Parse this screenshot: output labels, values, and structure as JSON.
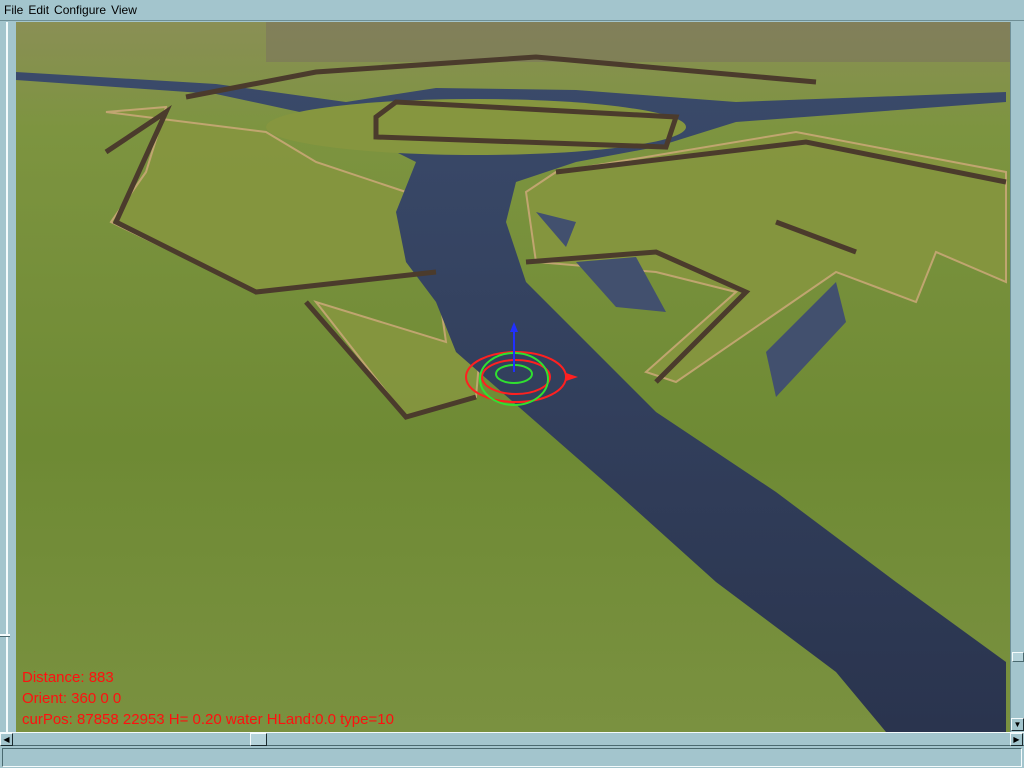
{
  "menu": [
    "File",
    "Edit",
    "Configure",
    "View"
  ],
  "hud": {
    "distance": "Distance: 883",
    "orient": "Orient: 360 0 0",
    "curpos": "curPos: 87858 22953 H= 0.20 water HLand:0.0 type=10"
  },
  "statusbar": {
    "text": ""
  },
  "colors": {
    "hud_text": "#ff1010",
    "chrome": "#a3c5cd",
    "water": "#2e3a56",
    "grass": "#6f8a36"
  }
}
